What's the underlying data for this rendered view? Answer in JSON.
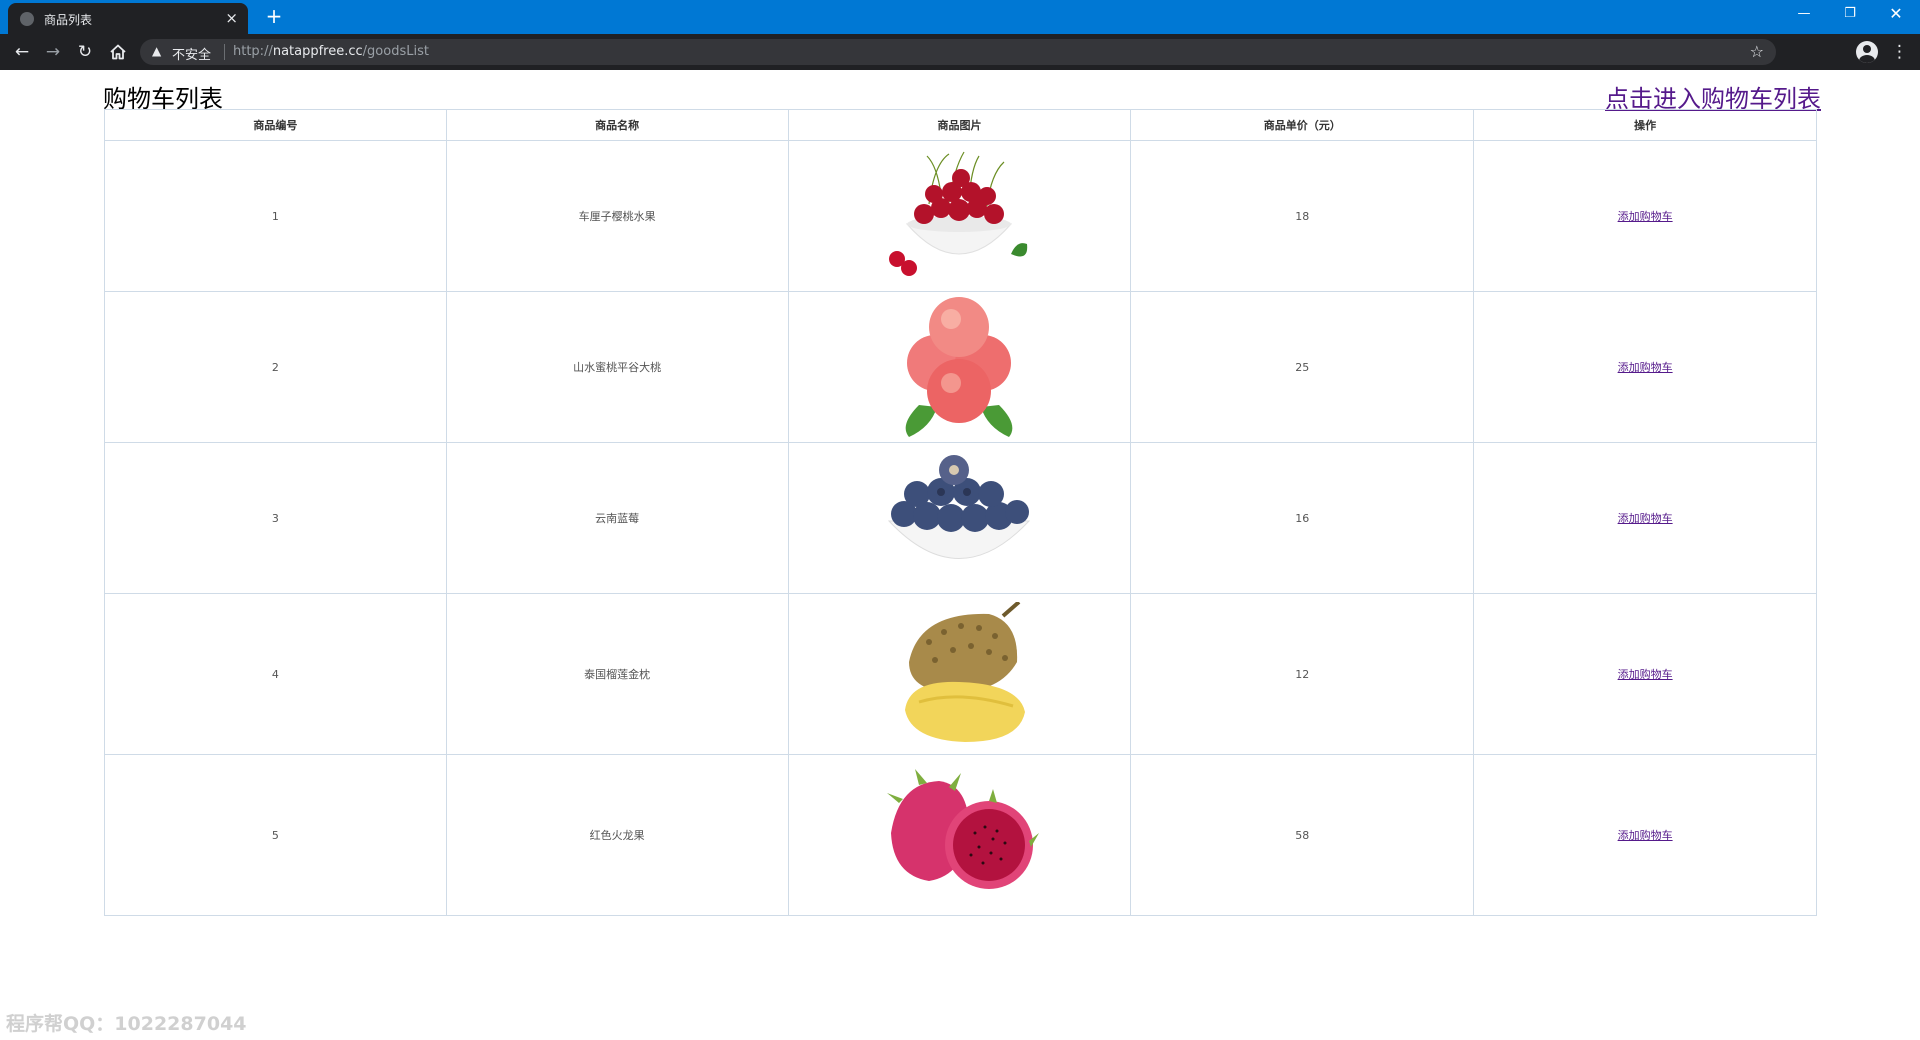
{
  "browser": {
    "tab_title": "商品列表",
    "tab_close": "×",
    "new_tab": "+",
    "insecure_label": "不安全",
    "url_prefix": "http://",
    "url_host": "natappfree.cc",
    "url_path": "/goodsList",
    "window_minimize": "—",
    "window_restore": "❐",
    "window_close": "✕"
  },
  "page": {
    "title": "购物车列表",
    "cart_link": "点击进入购物车列表"
  },
  "table": {
    "headers": [
      "商品编号",
      "商品名称",
      "商品图片",
      "商品单价（元）",
      "操作"
    ],
    "rows": [
      {
        "id": "1",
        "name": "车厘子樱桃水果",
        "price": "18",
        "action": "添加购物车",
        "image": "cherries"
      },
      {
        "id": "2",
        "name": "山水蜜桃平谷大桃",
        "price": "25",
        "action": "添加购物车",
        "image": "peaches"
      },
      {
        "id": "3",
        "name": "云南蓝莓",
        "price": "16",
        "action": "添加购物车",
        "image": "blueberries"
      },
      {
        "id": "4",
        "name": "泰国榴莲金枕",
        "price": "12",
        "action": "添加购物车",
        "image": "durian"
      },
      {
        "id": "5",
        "name": "红色火龙果",
        "price": "58",
        "action": "添加购物车",
        "image": "dragon-fruit"
      }
    ]
  },
  "watermark": "程序帮QQ：1022287044",
  "colors": {
    "titlebar": "#0078d4",
    "toolbar": "#202124",
    "link_visited": "#551a8b",
    "table_border": "#cfdbe7"
  }
}
